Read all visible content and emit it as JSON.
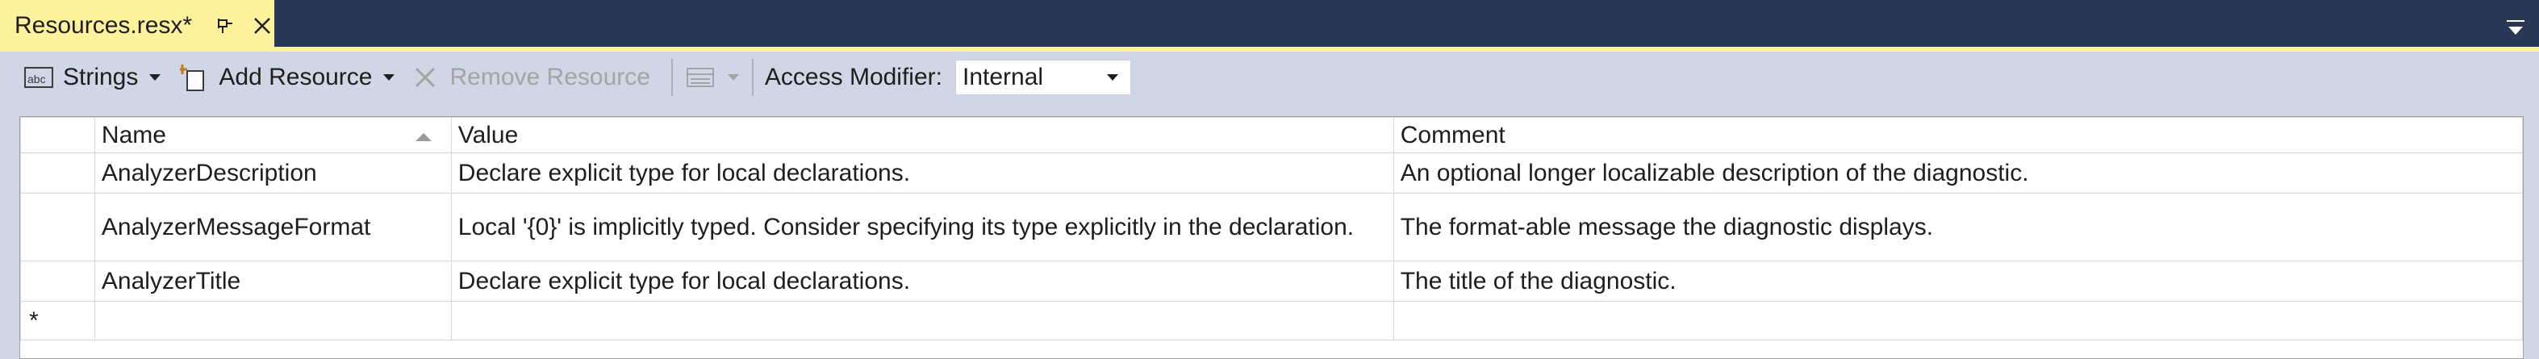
{
  "document_tab": {
    "title": "Resources.resx*",
    "pin_icon": "pin-icon",
    "close_icon": "close-icon",
    "overflow_icon": "chevron-down-icon"
  },
  "toolbar": {
    "strings_label": "Strings",
    "add_resource_label": "Add Resource",
    "remove_resource_label": "Remove Resource",
    "access_modifier_label": "Access Modifier:",
    "access_modifier_value": "Internal"
  },
  "grid": {
    "columns": [
      "Name",
      "Value",
      "Comment"
    ],
    "sort_column": "Name",
    "rows": [
      {
        "name": "AnalyzerDescription",
        "value": "Declare explicit type for local declarations.",
        "comment": "An optional longer localizable description of the diagnostic."
      },
      {
        "name": "AnalyzerMessageFormat",
        "value": "Local '{0}' is implicitly typed. Consider specifying its type explicitly in the declaration.",
        "comment": "The format-able message the diagnostic displays."
      },
      {
        "name": "AnalyzerTitle",
        "value": "Declare explicit type for local declarations.",
        "comment": "The title of the diagnostic."
      }
    ],
    "new_row_marker": "*"
  },
  "colors": {
    "tab_active": "#fff29d",
    "window_background": "#293955",
    "toolbar_background": "#cfd6e5"
  }
}
